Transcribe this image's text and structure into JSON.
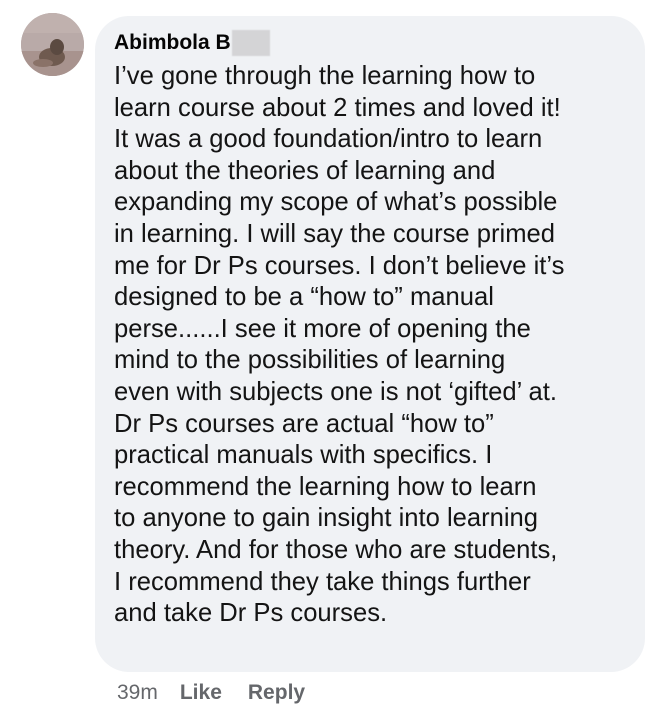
{
  "comment": {
    "author": "Abimbola B",
    "lines": [
      "I’ve gone through the learning how to",
      "learn course about 2 times and loved it!",
      "It was a good foundation/intro to learn",
      "about the theories of learning and",
      "expanding my scope of what’s possible",
      "in learning. I will say the course primed",
      "me for Dr Ps courses. I don’t believe it’s",
      "designed to be a “how to” manual",
      "perse......I see it more of opening the",
      "mind to the possibilities of learning",
      "even with subjects one is not ‘gifted’ at.",
      "Dr Ps courses are actual “how to”",
      "practical manuals with specifics. I",
      "recommend the learning how to learn",
      "to anyone to gain insight into learning",
      "theory. And for those who are students,",
      "I recommend they take things further",
      "and take Dr Ps courses."
    ]
  },
  "actions": {
    "timestamp": "39m",
    "like_label": "Like",
    "reply_label": "Reply"
  },
  "colors": {
    "bubble_background": "#f0f2f5",
    "secondary_text": "#65676b",
    "primary_text": "#050505"
  }
}
